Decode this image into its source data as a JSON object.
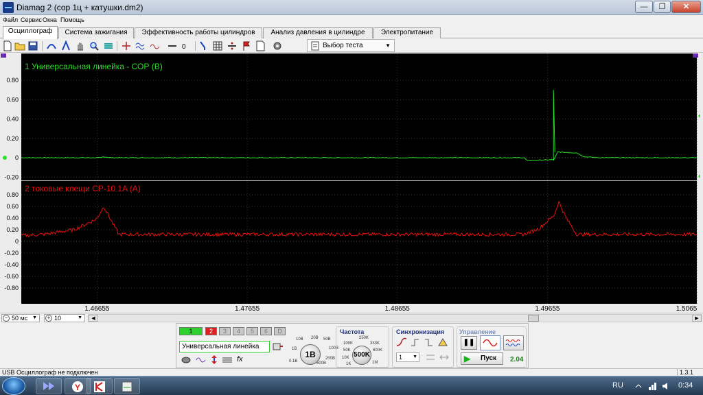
{
  "window": {
    "title": "Diamag 2 (сор 1ц  + катушки.dm2)",
    "minimize_glyph": "—",
    "restore_glyph": "❐",
    "close_glyph": "✕"
  },
  "menu": [
    "Файл",
    "Сервис",
    "Окна",
    "Помощь"
  ],
  "tabs": [
    {
      "label": "Осциллограф",
      "active": true
    },
    {
      "label": "Система зажигания",
      "active": false
    },
    {
      "label": "Эффективность работы цилиндров",
      "active": false
    },
    {
      "label": "Анализ давления в цилиндре",
      "active": false
    },
    {
      "label": "Электропитание",
      "active": false
    }
  ],
  "toolbar": {
    "test_select_label": "Выбор теста",
    "icons": [
      "new-file-icon",
      "open-folder-icon",
      "save-icon",
      "cursor-a-icon",
      "cursor-b-icon",
      "hand-pan-icon",
      "zoom-icon",
      "stack-icon",
      "filter-icon",
      "waves-icon",
      "wave-plus-icon",
      "wave-minus-icon",
      "zero-icon",
      "marker-icon",
      "grid-icon",
      "divide-icon",
      "flag-icon",
      "page-icon",
      "settings-gear-icon"
    ]
  },
  "channels": [
    {
      "label": "1 Универсальная линейка - СОР (В)",
      "color": "#28e028"
    },
    {
      "label": "2 токовые клещи CP-10 1A (A)",
      "color": "#e81010"
    }
  ],
  "y_ticks": [
    "0.80",
    "0.60",
    "0.40",
    "0.20",
    "0",
    "-0.20",
    "-0.40",
    "-0.60",
    "-0.80"
  ],
  "x_ticks": [
    "1.46655",
    "1.47655",
    "1.48655",
    "1.49655",
    "1.5065"
  ],
  "bottom": {
    "timebase": "50 мс",
    "count": "10"
  },
  "control": {
    "channel_buttons": [
      "1",
      "2",
      "3",
      "4",
      "5",
      "6",
      "D"
    ],
    "channel_name": "Универсальная линейка",
    "range_ticks": [
      "10B",
      "20B",
      "50B",
      "100B",
      "200B",
      "500B",
      "0.1B",
      "1B"
    ],
    "range_value": "1B",
    "freq_title": "Частота",
    "freq_ticks": [
      "250K",
      "100K",
      "333K",
      "50K",
      "600K",
      "10K",
      "1K",
      "1M"
    ],
    "freq_value": "500K",
    "sync_title": "Синхронизация",
    "sync_channel": "1",
    "manage_title": "Управление",
    "run_label": "Пуск",
    "run_value": "2.04"
  },
  "status": {
    "left": "USB Осциллограф не подключен",
    "version": "1.3.1"
  },
  "taskbar": {
    "lang": "RU",
    "time": "0:34"
  },
  "chart_data": [
    {
      "type": "line",
      "title": "1 Универсальная линейка - СОР (В)",
      "ylim": [
        -0.8,
        0.9
      ],
      "xlim": [
        1.4615,
        1.5065
      ],
      "x_ticks": [
        1.46655,
        1.47655,
        1.48655,
        1.49655,
        1.5065
      ],
      "series": [
        {
          "name": "1 Универсальная линейка - СОР (В)",
          "color": "#28e028",
          "x": [
            1.4615,
            1.4668,
            1.467,
            1.4675,
            1.495,
            1.4952,
            1.497,
            1.4972,
            1.49695,
            1.497,
            1.4971,
            1.4985,
            1.499,
            1.5,
            1.5065
          ],
          "y": [
            0.0,
            0.0,
            0.01,
            0.0,
            0.0,
            -0.03,
            -0.02,
            0.05,
            0.7,
            0.06,
            0.06,
            0.05,
            0.01,
            0.0,
            0.0
          ]
        }
      ]
    },
    {
      "type": "line",
      "title": "2 токовые клещи CP-10 1A (A)",
      "ylim": [
        -0.8,
        0.9
      ],
      "xlim": [
        1.4615,
        1.5065
      ],
      "x_ticks": [
        1.46655,
        1.47655,
        1.48655,
        1.49655,
        1.5065
      ],
      "series": [
        {
          "name": "2 токовые клещи CP-10 1A (A)",
          "color": "#e81010",
          "x": [
            1.4615,
            1.463,
            1.465,
            1.4665,
            1.467,
            1.4675,
            1.468,
            1.495,
            1.496,
            1.497,
            1.4973,
            1.4978,
            1.4985,
            1.5065
          ],
          "y": [
            0.1,
            0.12,
            0.2,
            0.38,
            0.6,
            0.35,
            0.12,
            0.12,
            0.22,
            0.45,
            0.68,
            0.4,
            0.12,
            0.12
          ]
        }
      ]
    }
  ]
}
